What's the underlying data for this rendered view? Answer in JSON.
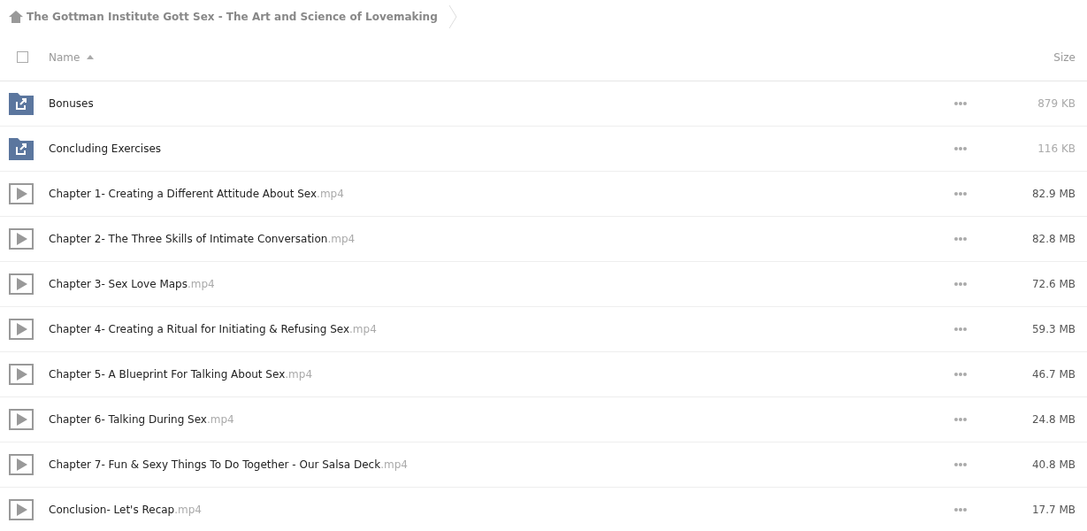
{
  "breadcrumb": {
    "title": "The Gottman Institute Gott Sex - The Art and Science of Lovemaking"
  },
  "header": {
    "select_all": {
      "checked": false
    },
    "name_label": "Name",
    "size_label": "Size"
  },
  "rows": [
    {
      "kind": "folder",
      "name": "Bonuses",
      "size": "879 KB"
    },
    {
      "kind": "folder",
      "name": "Concluding Exercises",
      "size": "116 KB"
    },
    {
      "kind": "video",
      "name": "Chapter 1- Creating a Different Attitude About Sex",
      "ext": ".mp4",
      "size": "82.9 MB"
    },
    {
      "kind": "video",
      "name": "Chapter 2- The Three Skills of Intimate Conversation",
      "ext": ".mp4",
      "size": "82.8 MB"
    },
    {
      "kind": "video",
      "name": "Chapter 3- Sex Love Maps",
      "ext": ".mp4",
      "size": "72.6 MB"
    },
    {
      "kind": "video",
      "name": "Chapter 4- Creating a Ritual for Initiating & Refusing Sex",
      "ext": ".mp4",
      "size": "59.3 MB"
    },
    {
      "kind": "video",
      "name": "Chapter 5- A Blueprint For Talking About Sex",
      "ext": ".mp4",
      "size": "46.7 MB"
    },
    {
      "kind": "video",
      "name": "Chapter 6- Talking During Sex",
      "ext": ".mp4",
      "size": "24.8 MB"
    },
    {
      "kind": "video",
      "name": "Chapter 7- Fun & Sexy Things To Do Together - Our Salsa Deck",
      "ext": ".mp4",
      "size": "40.8 MB"
    },
    {
      "kind": "video",
      "name": "Conclusion- Let's Recap",
      "ext": ".mp4",
      "size": "17.7 MB"
    }
  ]
}
